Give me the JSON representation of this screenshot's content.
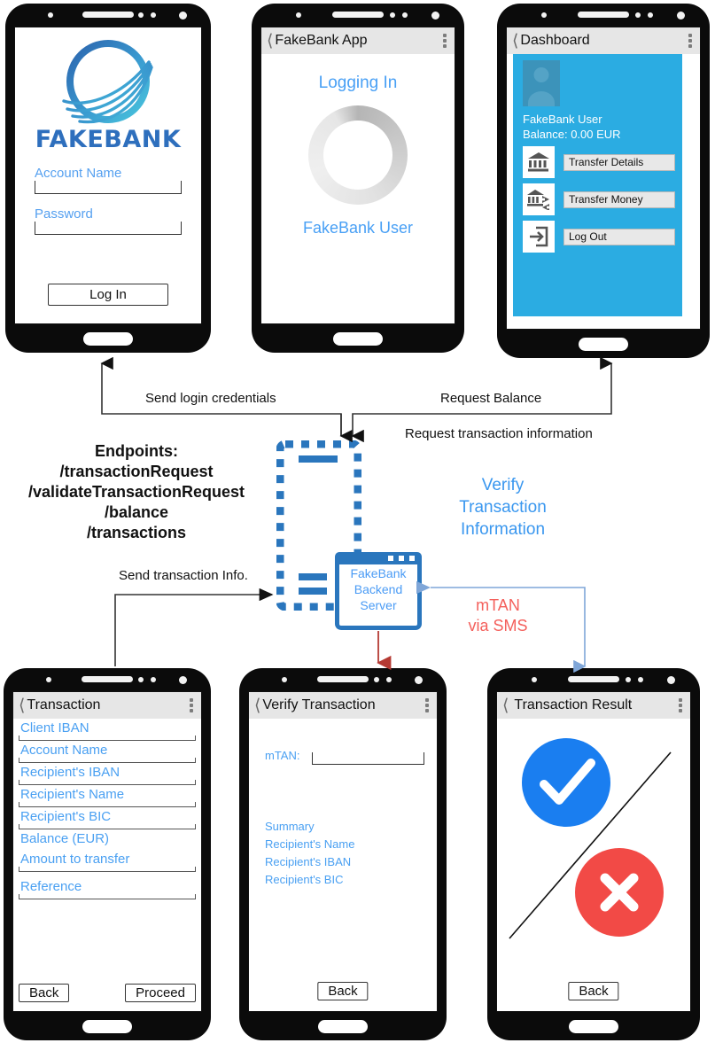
{
  "diagram": {
    "title": "FakeBank app architecture flow",
    "accent_blue": "#2a76bd",
    "dashboard_blue": "#2bace2",
    "link_blue": "#4aa0f2",
    "red": "#f4605c"
  },
  "phone_login": {
    "brand": "FAKEBANK",
    "logo_icon": "fakebank-swoosh-logo",
    "fields": [
      {
        "label": "Account Name",
        "value": "",
        "placeholder": "Account Name"
      },
      {
        "label": "Password",
        "value": "",
        "placeholder": "Password"
      }
    ],
    "login_button": "Log In"
  },
  "phone_logging_in": {
    "title": "FakeBank App",
    "back_icon": "chevron-left-icon",
    "menu_icon": "kebab-menu-icon",
    "status": "Logging In",
    "spinner_icon": "loading-spinner-icon",
    "user": "FakeBank User"
  },
  "phone_dashboard": {
    "title": "Dashboard",
    "back_icon": "chevron-left-icon",
    "menu_icon": "kebab-menu-icon",
    "avatar_icon": "user-avatar-icon",
    "user": "FakeBank User",
    "balance": "Balance: 0.00 EUR",
    "actions": [
      {
        "label": "Transfer Details",
        "icon": "bank-building-icon"
      },
      {
        "label": "Transfer Money",
        "icon": "bank-transfer-icon"
      },
      {
        "label": "Log Out",
        "icon": "logout-arrow-icon"
      }
    ]
  },
  "phone_transaction": {
    "title": "Transaction",
    "back_icon": "chevron-left-icon",
    "menu_icon": "kebab-menu-icon",
    "fields": [
      {
        "label": "Client IBAN",
        "value": "",
        "boxed": true
      },
      {
        "label": "Account Name",
        "value": "",
        "boxed": true
      },
      {
        "label": "Recipient's IBAN",
        "value": "",
        "boxed": true
      },
      {
        "label": "Recipient's Name",
        "value": "",
        "boxed": true
      },
      {
        "label": "Recipient's BIC",
        "value": "",
        "boxed": true
      },
      {
        "label": "Balance (EUR)",
        "value": "",
        "boxed": false
      },
      {
        "label": "Amount to transfer",
        "value": "",
        "boxed": true
      },
      {
        "label": "Reference",
        "value": "",
        "boxed": true
      }
    ],
    "back_button": "Back",
    "proceed_button": "Proceed"
  },
  "phone_verify": {
    "title": "Verify Transaction",
    "back_icon": "chevron-left-icon",
    "menu_icon": "kebab-menu-icon",
    "mtan_label": "mTAN:",
    "mtan_value": "",
    "summary": [
      "Summary",
      "Recipient's Name",
      "Recipient's IBAN",
      "Recipient's BIC"
    ],
    "back_button": "Back"
  },
  "phone_result": {
    "title": "Transaction Result",
    "back_icon": "chevron-left-icon",
    "menu_icon": "kebab-menu-icon",
    "success_icon": "check-circle-icon",
    "failure_icon": "x-circle-icon",
    "divider_icon": "diagonal-divider-line",
    "back_button": "Back"
  },
  "flow": {
    "endpoints_heading": "Endpoints:",
    "endpoints": [
      "/transactionRequest",
      "/validateTransactionRequest",
      "/balance",
      "/transactions"
    ],
    "arrows": [
      {
        "label": "Send login credentials"
      },
      {
        "label": "Request Balance"
      },
      {
        "label": "Request transaction information"
      },
      {
        "label": "Send transaction Info."
      }
    ],
    "verify_note": "Verify\nTransaction\nInformation",
    "verify_note_lines": [
      "Verify",
      "Transaction",
      "Information"
    ],
    "mtan_note_lines": [
      "mTAN",
      "via SMS"
    ],
    "server": {
      "icon": "server-window-icon",
      "lines": [
        "FakeBank",
        "Backend",
        "Server"
      ]
    },
    "app_node_icon": "dashed-phone-outline-icon"
  }
}
